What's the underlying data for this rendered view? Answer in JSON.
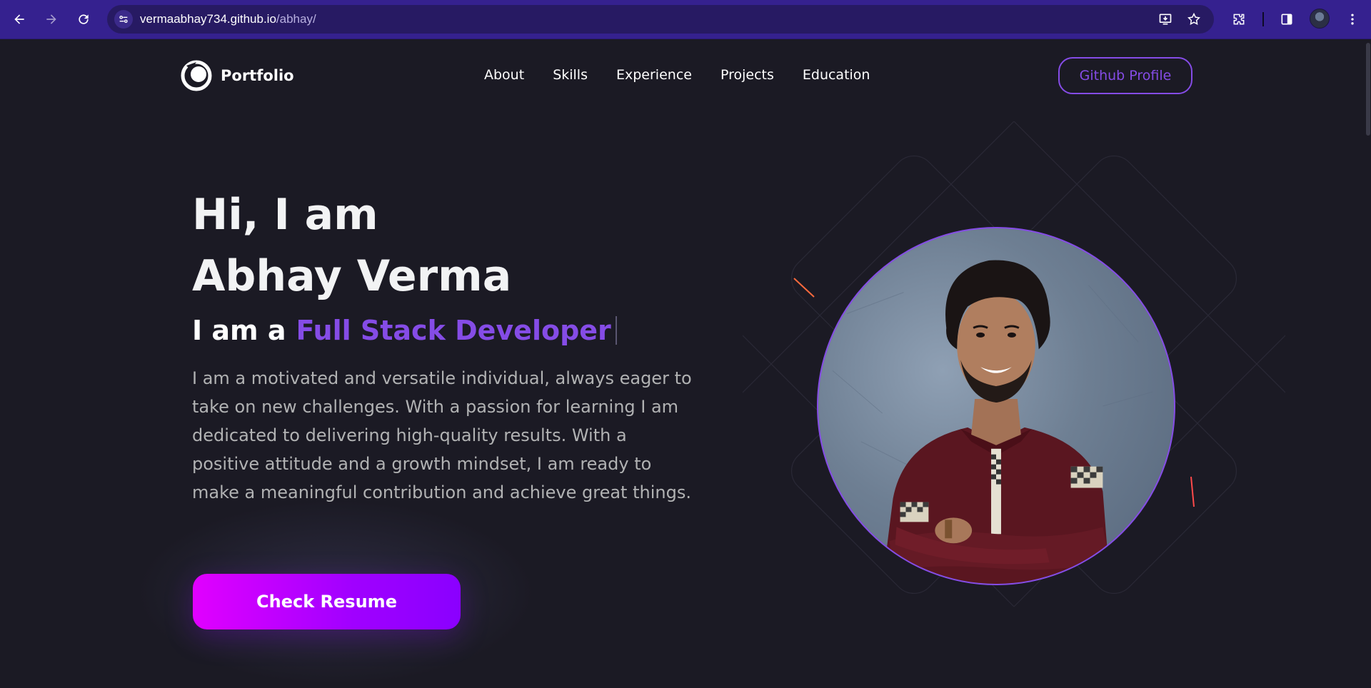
{
  "browser": {
    "url_host": "vermaabhay734.github.io",
    "url_path": "/abhay/"
  },
  "nav": {
    "logo_text": "Portfolio",
    "links": [
      "About",
      "Skills",
      "Experience",
      "Projects",
      "Education"
    ],
    "github_button": "Github Profile"
  },
  "hero": {
    "title_line1": "Hi, I am",
    "title_line2": "Abhay Verma",
    "role_prefix": "I am a",
    "role_typed": "Full Stack Developer",
    "description": "I am a motivated and versatile individual, always eager to take on new challenges. With a passion for learning I am dedicated to delivering high-quality results. With a positive attitude and a growth mindset, I am ready to make a meaningful contribution and achieve great things.",
    "resume_button": "Check Resume"
  },
  "colors": {
    "background": "#1b1a24",
    "accent": "#854ce6",
    "chrome": "#35218f",
    "button_gradient_start": "#e100ff",
    "button_gradient_end": "#8a00ff"
  },
  "icons": {
    "back": "arrow-left-icon",
    "forward": "arrow-right-icon",
    "reload": "reload-icon",
    "site_info": "tune-icon",
    "install": "install-icon",
    "bookmark": "star-icon",
    "extensions": "puzzle-icon",
    "side_panel": "side-panel-icon",
    "menu": "kebab-menu-icon"
  }
}
